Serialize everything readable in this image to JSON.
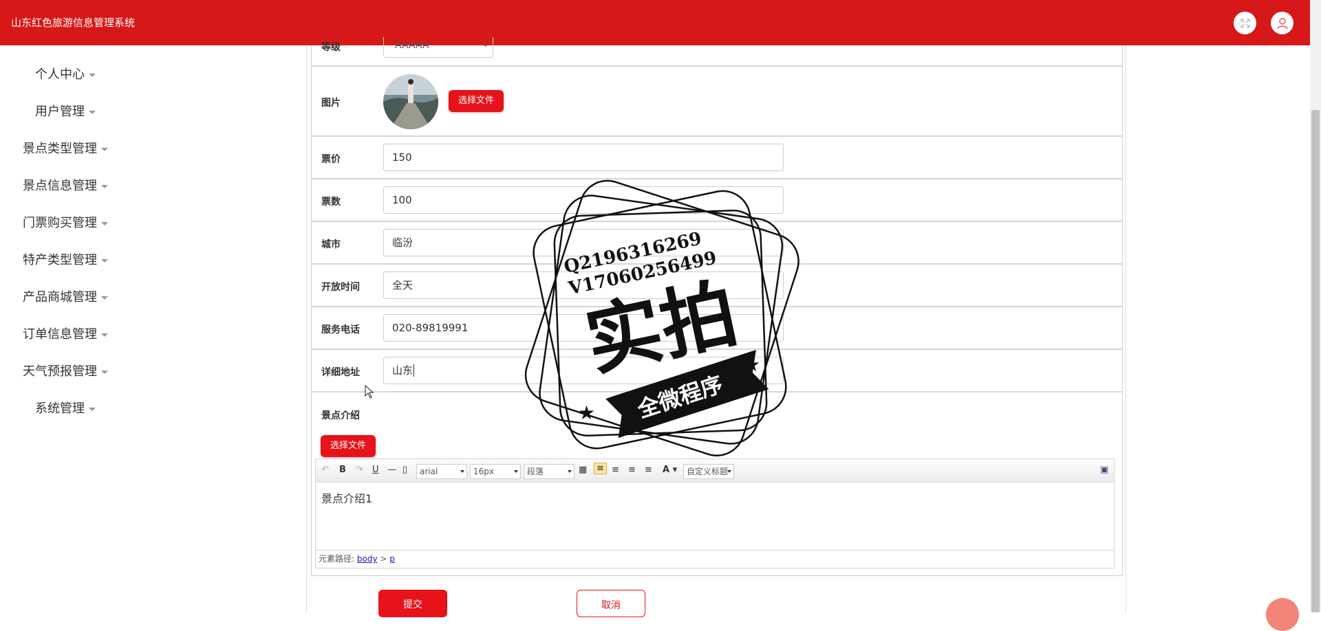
{
  "header": {
    "title": "山东红色旅游信息管理系统",
    "fullscreen_icon": "expand-icon",
    "user_icon": "user-icon",
    "bg_color": "#d71818"
  },
  "sidebar": {
    "items": [
      {
        "label": "个人中心"
      },
      {
        "label": "用户管理"
      },
      {
        "label": "景点类型管理"
      },
      {
        "label": "景点信息管理"
      },
      {
        "label": "门票购买管理"
      },
      {
        "label": "特产类型管理"
      },
      {
        "label": "产品商城管理"
      },
      {
        "label": "订单信息管理"
      },
      {
        "label": "天气预报管理"
      },
      {
        "label": "系统管理"
      }
    ]
  },
  "form": {
    "grade": {
      "label": "等级",
      "value": "AAAAA"
    },
    "image": {
      "label": "图片",
      "button": "选择文件"
    },
    "price": {
      "label": "票价",
      "value": "150"
    },
    "ticket_count": {
      "label": "票数",
      "value": "100"
    },
    "city": {
      "label": "城市",
      "value": "临汾"
    },
    "open_time": {
      "label": "开放时间",
      "value": "全天"
    },
    "phone": {
      "label": "服务电话",
      "value": "020-89819991"
    },
    "address": {
      "label": "详细地址",
      "value": "山东"
    },
    "intro": {
      "label": "景点介绍",
      "button": "选择文件"
    }
  },
  "editor": {
    "font_family": "arial",
    "font_size": "16px",
    "paragraph": "段落",
    "custom_title": "自定义标题",
    "content": "景点介绍1",
    "path_label": "元素路径:",
    "path_body": "body",
    "path_sep": " > ",
    "path_p": "p"
  },
  "actions": {
    "submit": "提交",
    "cancel": "取消"
  },
  "watermark": {
    "line1": "Q2196316269",
    "line2": "V17060256499",
    "main": "实拍",
    "ribbon": "全微程序"
  },
  "colors": {
    "accent": "#e8121a",
    "border": "#d6d6d6"
  }
}
